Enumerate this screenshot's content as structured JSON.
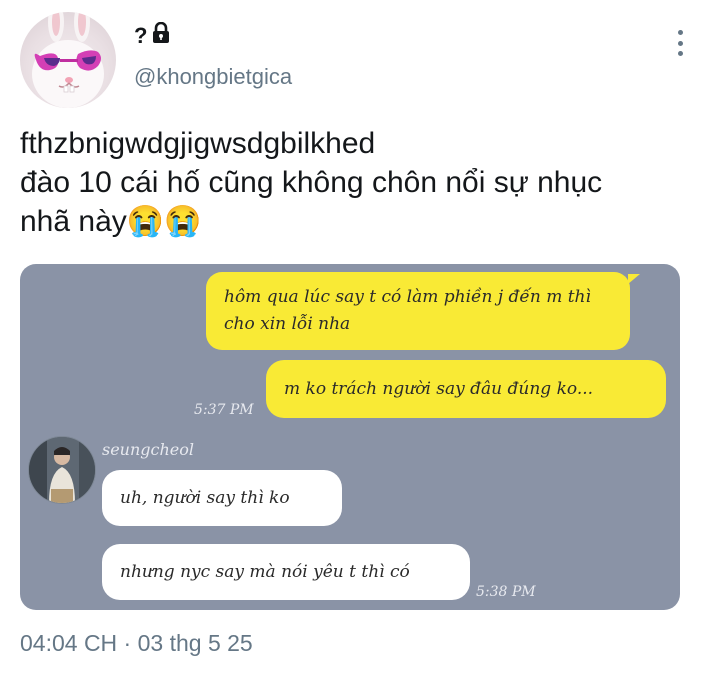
{
  "author": {
    "display_name": "?",
    "handle": "@khongbietgica",
    "lock_icon": "lock-icon"
  },
  "tweet": {
    "text": "fthzbnigwdgjigwsdgbilkhed\nđào 10 cái hố cũng không chôn nổi sự nhục\nnhã này😭😭",
    "timestamp": "04:04 CH · 03 thg 5 25"
  },
  "chat": {
    "messages_out": [
      "hôm qua lúc say t có làm phiền j đến m thì\ncho xin lỗi nha",
      "m ko trách người say đâu đúng ko..."
    ],
    "time_out": "5:37 PM",
    "sender_name": "seungcheol",
    "messages_in": [
      "uh, người say thì ko",
      "nhưng nyc say mà nói yêu t thì có"
    ],
    "time_in": "5:38 PM"
  },
  "colors": {
    "chat_background": "#8a93a6",
    "outgoing_bubble": "#f9ea35",
    "incoming_bubble": "#ffffff",
    "secondary_text": "#657786"
  }
}
